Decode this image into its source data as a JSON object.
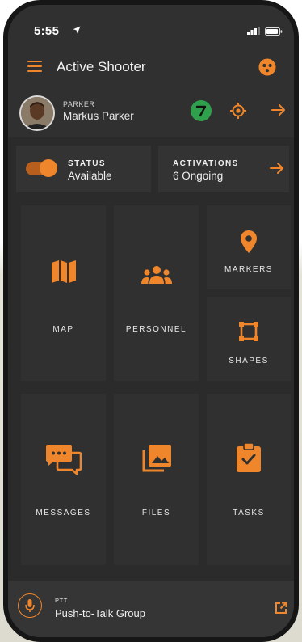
{
  "status_bar": {
    "time": "5:55"
  },
  "app_bar": {
    "title": "Active Shooter"
  },
  "profile": {
    "role": "PARKER",
    "name": "Markus Parker"
  },
  "status_card": {
    "label": "STATUS",
    "value": "Available",
    "toggle_on": true
  },
  "activations_card": {
    "label": "ACTIVATIONS",
    "value": "6 Ongoing"
  },
  "tiles": {
    "map": "MAP",
    "personnel": "PERSONNEL",
    "markers": "MARKERS",
    "shapes": "SHAPES",
    "messages": "MESSAGES",
    "files": "FILES",
    "tasks": "TASKS"
  },
  "ptt": {
    "label": "PTT",
    "group": "Push-to-Talk Group"
  },
  "colors": {
    "accent": "#f0862b",
    "background": "#2b2b2b",
    "tile": "#303030",
    "badge_green": "#2fa14d"
  },
  "icons": {
    "menu": "hamburger-icon",
    "app_menu": "dots-circle-icon",
    "badge": "lightning-icon",
    "locate": "crosshair-icon",
    "map": "folded-map-icon",
    "personnel": "group-icon",
    "markers": "location-pin-icon",
    "shapes": "square-shape-icon",
    "messages": "chat-bubbles-icon",
    "files": "image-gallery-icon",
    "tasks": "clipboard-check-icon",
    "ptt": "microphone-icon",
    "external": "open-external-icon"
  }
}
